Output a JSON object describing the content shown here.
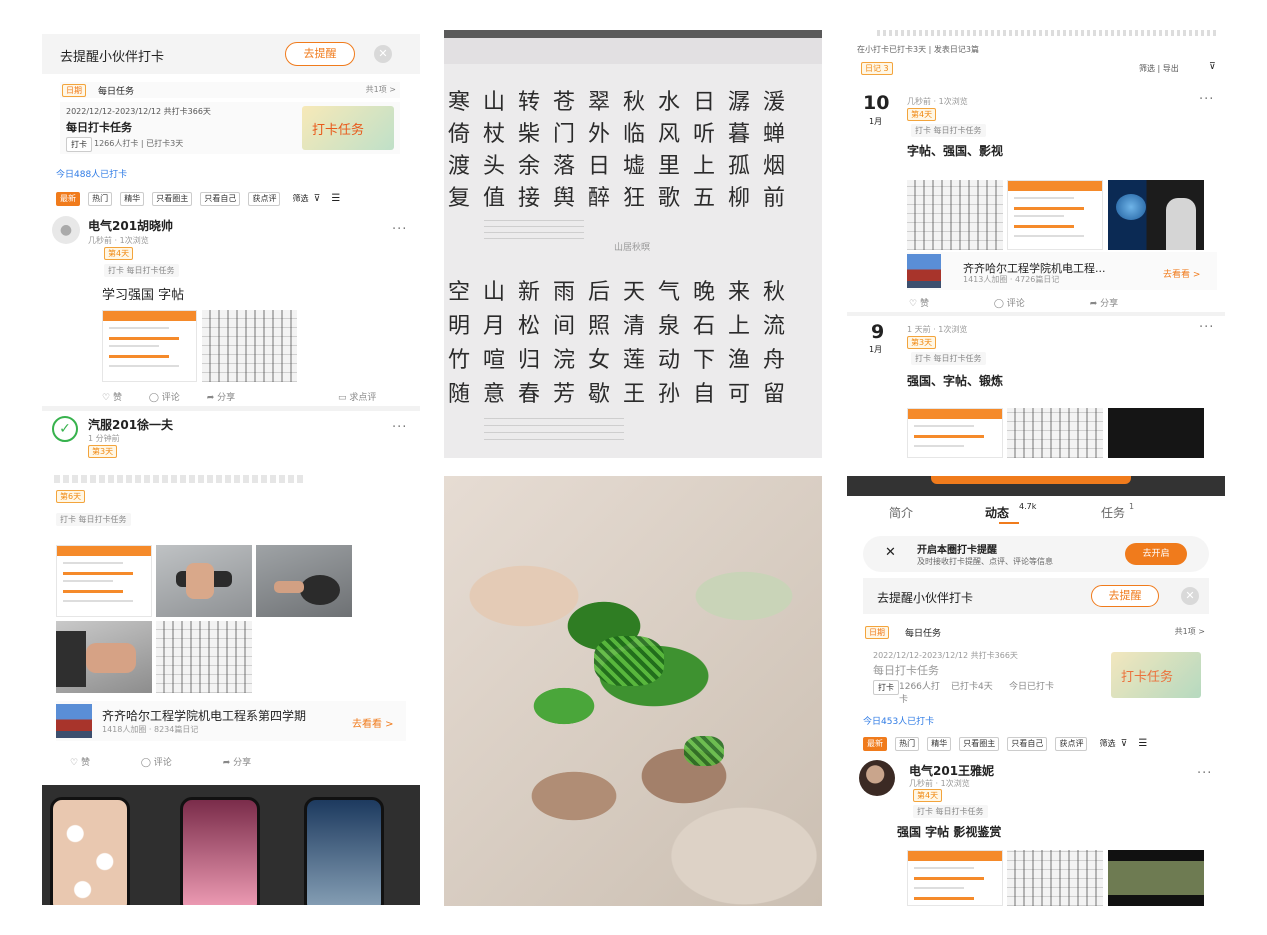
{
  "panel_a": {
    "remind_text": "去提醒小伙伴打卡",
    "remind_button": "去提醒",
    "daily_tag": "日期",
    "daily_label": "每日任务",
    "count_label": "共1项 >",
    "date_range": "2022/12/12-2023/12/12 共打卡366天",
    "task_title": "每日打卡任务",
    "task_tag": "打卡",
    "task_stats": "1266人打卡 | 已打卡3天",
    "banner_text": "打卡任务",
    "today_count": "今日488人已打卡",
    "filters": [
      "最新",
      "热门",
      "精华",
      "只看圈主",
      "只看自己",
      "获点评"
    ],
    "filter_label": "筛选",
    "post1": {
      "name": "电气201胡晓帅",
      "meta": "几秒前 · 1次浏览",
      "day_tag": "第4天",
      "task_label": "打卡 每日打卡任务",
      "content": "学习强国 字帖",
      "like": "赞",
      "comment": "评论",
      "share": "分享",
      "ask_review": "求点评"
    },
    "post2": {
      "name": "汽服201徐一夫",
      "meta": "1 分钟前",
      "day_tag": "第3天"
    }
  },
  "panel_b": {
    "day_tag": "第6天",
    "task_label": "打卡 每日打卡任务",
    "group_name": "齐齐哈尔工程学院机电工程系第四学期",
    "group_stats": "1418人加圈 · 8234篇日记",
    "go_see": "去看看 >",
    "like": "赞",
    "comment": "评论",
    "share": "分享"
  },
  "panel_c": {
    "rows_top": [
      "寒山转苍翠秋水日潺湲",
      "倚杖柴门外临风听暮蝉",
      "渡头余落日墟里上孤烟",
      "复值接舆醉狂歌五柳前"
    ],
    "subtitle": "山居秋暝",
    "rows_bottom": [
      "空山新雨后天气晚来秋",
      "明月松间照清泉石上流",
      "竹喧归浣女莲动下渔舟",
      "随意春芳歇王孙自可留"
    ]
  },
  "panel_e": {
    "header": "在小打卡已打卡3天 | 发表日记3篇",
    "diary_tag": "日记 3",
    "filter_export": "筛选 | 导出",
    "entry1": {
      "day": "10",
      "month": "1月",
      "meta": "几秒前 · 1次浏览",
      "day_tag": "第4天",
      "task_label": "打卡 每日打卡任务",
      "content": "字帖、强国、影视",
      "group_name": "齐齐哈尔工程学院机电工程...",
      "group_stats": "1413人加圈 · 4726篇日记",
      "go_see": "去看看 >",
      "like": "赞",
      "comment": "评论",
      "share": "分享"
    },
    "entry2": {
      "day": "9",
      "month": "1月",
      "meta": "1 天前 · 1次浏览",
      "day_tag": "第3天",
      "task_label": "打卡 每日打卡任务",
      "content": "强国、字帖、锻炼"
    }
  },
  "panel_f": {
    "tabs": [
      "简介",
      "动态",
      "任务"
    ],
    "tab_badges": [
      "",
      "4.7k",
      "1"
    ],
    "notify_title": "开启本圈打卡提醒",
    "notify_sub": "及时接收打卡提醒、点评、评论等信息",
    "notify_button": "去开启",
    "remind_text": "去提醒小伙伴打卡",
    "remind_button": "去提醒",
    "daily_tag": "日期",
    "daily_label": "每日任务",
    "count_label": "共1项 >",
    "date_range": "2022/12/12-2023/12/12 共打卡366天",
    "task_title": "每日打卡任务",
    "task_tag": "打卡",
    "task_stats_1": "1266人打卡",
    "task_stats_2": "已打卡4天",
    "task_stats_3": "今日已打卡",
    "banner_text": "打卡任务",
    "today_count": "今日453人已打卡",
    "filters": [
      "最新",
      "热门",
      "精华",
      "只看圈主",
      "只看自己",
      "获点评"
    ],
    "filter_label": "筛选",
    "post": {
      "name": "电气201王雅妮",
      "meta": "几秒前 · 1次浏览",
      "day_tag": "第4天",
      "task_label": "打卡 每日打卡任务",
      "content": "强国 字帖 影视鉴赏"
    }
  },
  "colors": {
    "accent": "#f07b1c",
    "tag_bg": "#fff7e6",
    "link_blue": "#2f7be5"
  }
}
